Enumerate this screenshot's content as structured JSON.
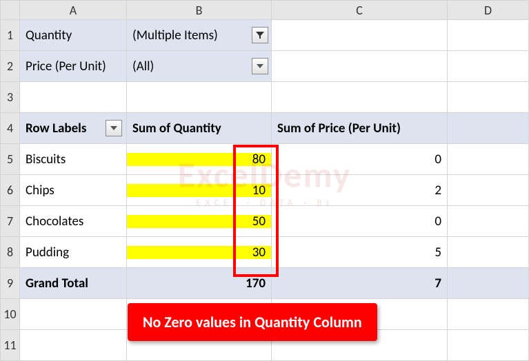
{
  "columns": {
    "A": "A",
    "B": "B",
    "C": "C",
    "D": "D"
  },
  "rows": [
    "1",
    "2",
    "3",
    "4",
    "5",
    "6",
    "7",
    "8",
    "9",
    "10",
    "11"
  ],
  "filters": [
    {
      "label": "Quantity",
      "value": "(Multiple Items)",
      "active": true
    },
    {
      "label": "Price (Per Unit)",
      "value": "(All)",
      "active": false
    }
  ],
  "headers": {
    "rowlabels": "Row Labels",
    "qty": "Sum of Quantity",
    "price": "Sum of Price (Per Unit)"
  },
  "data": [
    {
      "name": "Biscuits",
      "qty": "80",
      "price": "0"
    },
    {
      "name": "Chips",
      "qty": "10",
      "price": "2"
    },
    {
      "name": "Chocolates",
      "qty": "50",
      "price": "0"
    },
    {
      "name": "Pudding",
      "qty": "30",
      "price": "5"
    }
  ],
  "totals": {
    "label": "Grand Total",
    "qty": "170",
    "price": "7"
  },
  "callout": "No Zero values in Quantity Column",
  "watermark": {
    "main": "ExcelDemy",
    "sub": "EXCEL · DATA · BI"
  },
  "chart_data": {
    "type": "table",
    "title": "Pivot Table — Sum of Quantity, Sum of Price (Per Unit)",
    "columns": [
      "Row Labels",
      "Sum of Quantity",
      "Sum of Price (Per Unit)"
    ],
    "rows": [
      [
        "Biscuits",
        80,
        0
      ],
      [
        "Chips",
        10,
        2
      ],
      [
        "Chocolates",
        50,
        0
      ],
      [
        "Pudding",
        30,
        5
      ]
    ],
    "totals": [
      "Grand Total",
      170,
      7
    ]
  }
}
